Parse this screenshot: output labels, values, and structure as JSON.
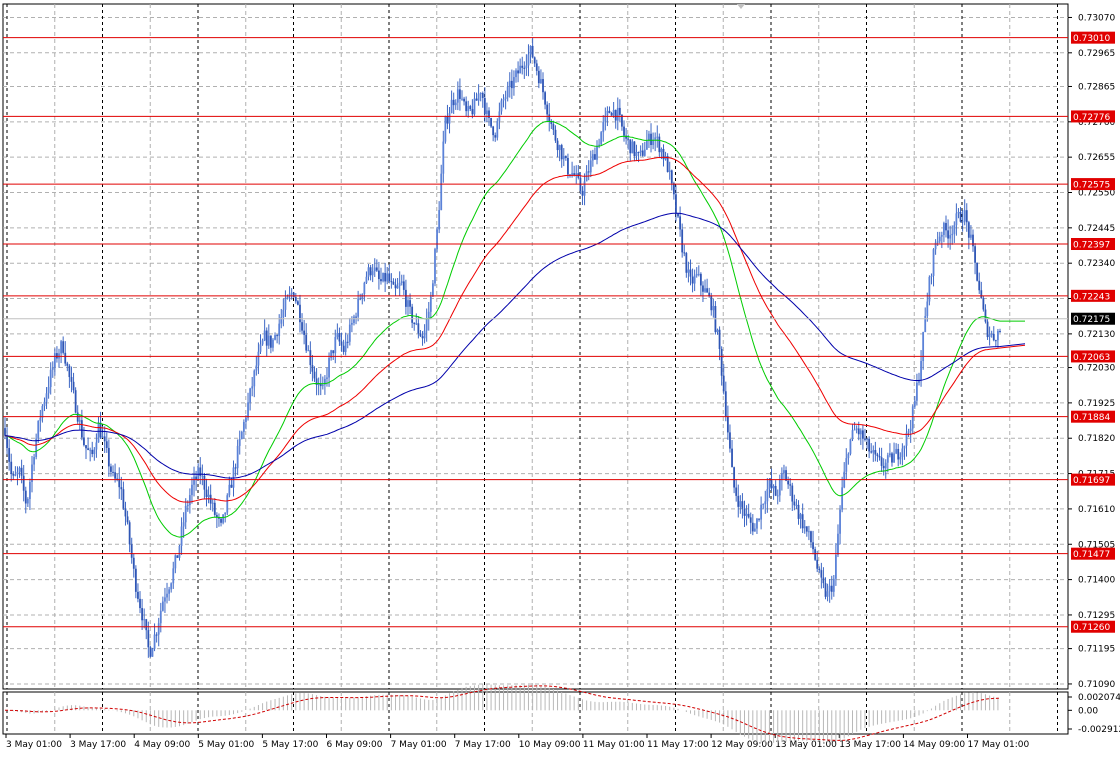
{
  "chart_data": [
    {
      "type": "candlestick",
      "symbol_hint": "",
      "y_axis": {
        "ticks": [
          "0.73070",
          "0.72965",
          "0.72865",
          "0.72760",
          "0.72655",
          "0.72550",
          "0.72445",
          "0.72340",
          "0.72235",
          "0.72130",
          "0.72030",
          "0.71925",
          "0.71820",
          "0.71715",
          "0.71610",
          "0.71505",
          "0.71400",
          "0.71295",
          "0.71195",
          "0.71090"
        ],
        "range": [
          0.71075,
          0.7311
        ]
      },
      "x_axis": {
        "labels": [
          "3 May 01:00",
          "3 May 17:00",
          "4 May 09:00",
          "5 May 01:00",
          "5 May 17:00",
          "6 May 09:00",
          "7 May 01:00",
          "7 May 17:00",
          "10 May 09:00",
          "11 May 01:00",
          "11 May 17:00",
          "12 May 09:00",
          "13 May 01:00",
          "13 May 17:00",
          "14 May 09:00",
          "17 May 01:00"
        ]
      },
      "grid": true,
      "levels": [
        {
          "value": 0.7301,
          "label": "0.73010",
          "color": "#e00000"
        },
        {
          "value": 0.72776,
          "label": "0.72776",
          "color": "#e00000"
        },
        {
          "value": 0.72575,
          "label": "0.72575",
          "color": "#e00000"
        },
        {
          "value": 0.72397,
          "label": "0.72397",
          "color": "#e00000"
        },
        {
          "value": 0.72243,
          "label": "0.72243",
          "color": "#e00000"
        },
        {
          "value": 0.72063,
          "label": "0.72063",
          "color": "#e00000"
        },
        {
          "value": 0.71884,
          "label": "0.71884",
          "color": "#e00000"
        },
        {
          "value": 0.71697,
          "label": "0.71697",
          "color": "#e00000"
        },
        {
          "value": 0.71477,
          "label": "0.71477",
          "color": "#e00000"
        },
        {
          "value": 0.7126,
          "label": "0.71260",
          "color": "#e00000"
        }
      ],
      "current_price": {
        "value": 0.72175,
        "label": "0.72175"
      },
      "price_path": [
        0.7185,
        0.7169,
        0.7172,
        0.7162,
        0.7178,
        0.719,
        0.7198,
        0.7206,
        0.721,
        0.7199,
        0.719,
        0.718,
        0.7176,
        0.7186,
        0.7178,
        0.717,
        0.7168,
        0.7155,
        0.714,
        0.713,
        0.7118,
        0.7125,
        0.7135,
        0.714,
        0.7148,
        0.716,
        0.7168,
        0.7172,
        0.7166,
        0.716,
        0.7155,
        0.7165,
        0.7175,
        0.7185,
        0.7195,
        0.7205,
        0.7212,
        0.721,
        0.7216,
        0.7222,
        0.7226,
        0.7218,
        0.7208,
        0.72,
        0.7195,
        0.7205,
        0.7212,
        0.7208,
        0.7215,
        0.7222,
        0.723,
        0.7233,
        0.7228,
        0.723,
        0.7225,
        0.7228,
        0.722,
        0.7215,
        0.7212,
        0.7222,
        0.7245,
        0.7275,
        0.7282,
        0.7285,
        0.7278,
        0.728,
        0.7286,
        0.7276,
        0.7273,
        0.7282,
        0.7286,
        0.729,
        0.7294,
        0.7297,
        0.729,
        0.7282,
        0.7273,
        0.7268,
        0.7262,
        0.726,
        0.7255,
        0.7262,
        0.7268,
        0.7275,
        0.728,
        0.7278,
        0.7271,
        0.7268,
        0.7265,
        0.727,
        0.7272,
        0.7268,
        0.7262,
        0.725,
        0.7238,
        0.7228,
        0.723,
        0.7226,
        0.7222,
        0.721,
        0.719,
        0.7168,
        0.7162,
        0.7158,
        0.7155,
        0.7163,
        0.7168,
        0.7165,
        0.7172,
        0.7166,
        0.716,
        0.7155,
        0.715,
        0.714,
        0.7135,
        0.714,
        0.7165,
        0.718,
        0.7185,
        0.7182,
        0.7178,
        0.7175,
        0.7174,
        0.7176,
        0.7178,
        0.7182,
        0.719,
        0.7205,
        0.7225,
        0.724,
        0.7244,
        0.7243,
        0.7247,
        0.7249,
        0.724,
        0.7228,
        0.7215,
        0.7212,
        0.7214
      ],
      "moving_averages": [
        {
          "color": "#00cc00",
          "period": 9
        },
        {
          "color": "#ee0000",
          "period": 17
        },
        {
          "color": "#0000aa",
          "period": 34
        }
      ],
      "oscillator": {
        "ticks": [
          "0.002074",
          "0.00",
          "-0.002912"
        ],
        "range": [
          -0.002912,
          0.002074
        ]
      }
    }
  ]
}
